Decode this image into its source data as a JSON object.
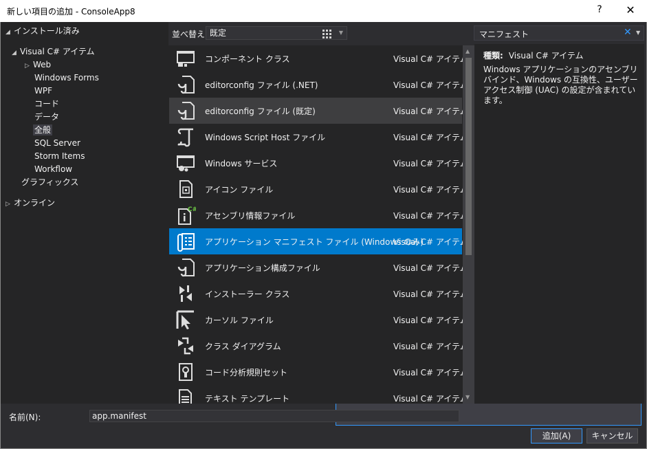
{
  "window": {
    "title": "新しい項目の追加 - ConsoleApp8",
    "help": "?",
    "close": "✕"
  },
  "tree": {
    "installed": "インストール済み",
    "visual_cs": "Visual C# アイテム",
    "web": "Web",
    "windows_forms": "Windows Forms",
    "wpf": "WPF",
    "code": "コード",
    "data": "データ",
    "general": "全般",
    "sql_server": "SQL Server",
    "storm_items": "Storm Items",
    "workflow": "Workflow",
    "graphics": "グラフィックス",
    "online": "オンライン"
  },
  "toolbar": {
    "sort_label": "並べ替え:",
    "sort_value": "既定"
  },
  "search": {
    "value": "マニフェスト",
    "clear": "✕"
  },
  "items": [
    {
      "name": "コンポーネント クラス",
      "category": "Visual C# アイテム",
      "icon": "component-icon"
    },
    {
      "name": "editorconfig ファイル (.NET)",
      "category": "Visual C# アイテム",
      "icon": "editorconfig-icon"
    },
    {
      "name": "editorconfig ファイル (既定)",
      "category": "Visual C# アイテム",
      "icon": "editorconfig-icon"
    },
    {
      "name": "Windows Script Host ファイル",
      "category": "Visual C# アイテム",
      "icon": "script-icon"
    },
    {
      "name": "Windows サービス",
      "category": "Visual C# アイテム",
      "icon": "service-icon"
    },
    {
      "name": "アイコン ファイル",
      "category": "Visual C# アイテム",
      "icon": "icon-file-icon"
    },
    {
      "name": "アセンブリ情報ファイル",
      "category": "Visual C# アイテム",
      "icon": "assembly-info-icon"
    },
    {
      "name": "アプリケーション マニフェスト ファイル (Windows のみ)",
      "category": "Visual C# アイテム",
      "icon": "manifest-icon"
    },
    {
      "name": "アプリケーション構成ファイル",
      "category": "Visual C# アイテム",
      "icon": "config-icon"
    },
    {
      "name": "インストーラー クラス",
      "category": "Visual C# アイテム",
      "icon": "installer-icon"
    },
    {
      "name": "カーソル ファイル",
      "category": "Visual C# アイテム",
      "icon": "cursor-icon"
    },
    {
      "name": "クラス ダイアグラム",
      "category": "Visual C# アイテム",
      "icon": "class-diagram-icon"
    },
    {
      "name": "コード分析規則セット",
      "category": "Visual C# アイテム",
      "icon": "ruleset-icon"
    },
    {
      "name": "テキスト テンプレート",
      "category": "Visual C# アイテム",
      "icon": "text-template-icon"
    }
  ],
  "details": {
    "type_label": "種類:",
    "type_value": "Visual C# アイテム",
    "description": "Windows アプリケーションのアセンブリ バインド、Windows の互換性、ユーザー アクセス制御 (UAC) の設定が含まれています。"
  },
  "footer": {
    "name_label": "名前(N):",
    "name_value": "app.manifest",
    "add": "追加(A)",
    "cancel": "キャンセル"
  }
}
